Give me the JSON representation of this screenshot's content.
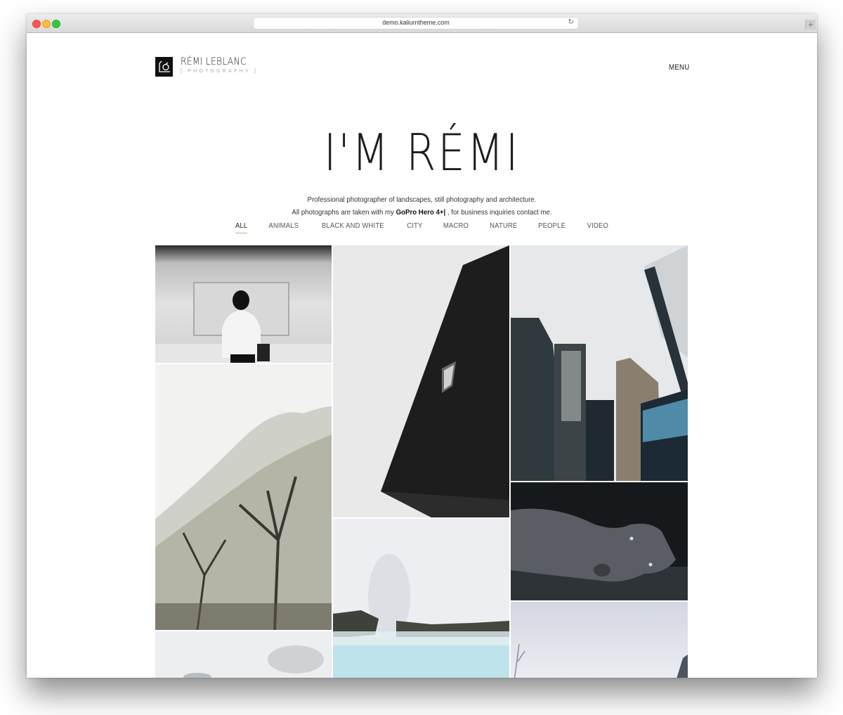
{
  "browser": {
    "url": "demo.kaliumtheme.com",
    "reload_icon": "↻",
    "new_tab_icon": "+"
  },
  "header": {
    "logo_name": "RÉMI LEBLANC",
    "logo_sub": "[ PHOTOGRAPHY ]",
    "menu_label": "MENU"
  },
  "hero": {
    "title": "I'M RÉMI",
    "line1": "Professional photographer of landscapes, still photography and architecture.",
    "line2_pre": "All photographs are taken with my ",
    "line2_bold": "GoPro Hero 4+|",
    "line2_post": " , for business inquiries contact me."
  },
  "filters": {
    "items": [
      {
        "label": "ALL",
        "active": true
      },
      {
        "label": "ANIMALS",
        "active": false
      },
      {
        "label": "BLACK AND WHITE",
        "active": false
      },
      {
        "label": "CITY",
        "active": false
      },
      {
        "label": "MACRO",
        "active": false
      },
      {
        "label": "NATURE",
        "active": false
      },
      {
        "label": "PEOPLE",
        "active": false
      },
      {
        "label": "VIDEO",
        "active": false
      }
    ],
    "active_color": "#c8b27a"
  },
  "gallery": {
    "items": [
      {
        "subject": "woman-at-subway-platform"
      },
      {
        "subject": "black-building-corner"
      },
      {
        "subject": "city-skyscrapers-fog"
      },
      {
        "subject": "snowy-tree"
      },
      {
        "subject": "weimaraner-dog"
      },
      {
        "subject": "geothermal-lagoon"
      },
      {
        "subject": "cloudy-landscape"
      },
      {
        "subject": "winter-sky-branches"
      }
    ]
  }
}
